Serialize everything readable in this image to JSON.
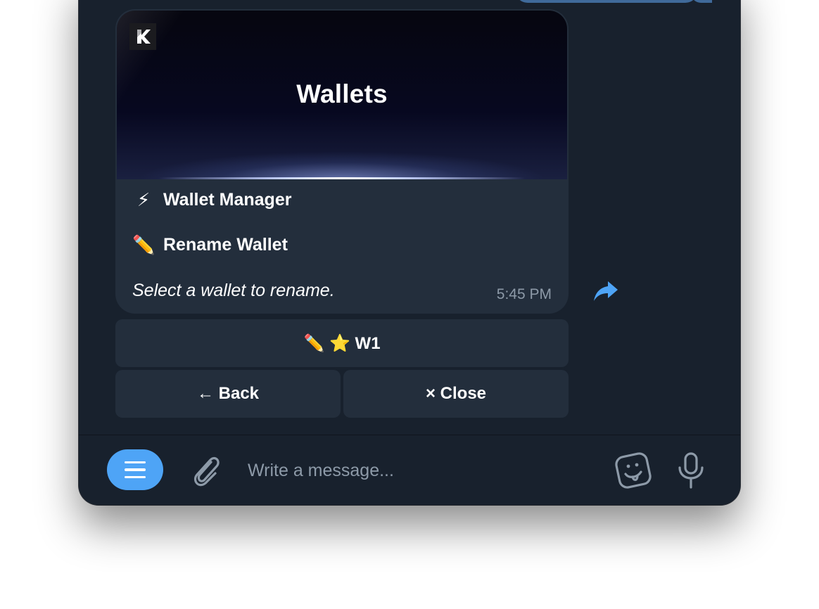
{
  "message": {
    "banner_title": "Wallets",
    "line1_emoji": "⚡",
    "line1_text": "Wallet Manager",
    "line2_emoji": "✏️",
    "line2_text": "Rename Wallet",
    "prompt": "Select a wallet to rename.",
    "time": "5:45 PM"
  },
  "keyboard": {
    "wallet_button": "✏️ ⭐ W1",
    "back_button": "← Back",
    "close_button": "× Close"
  },
  "composer": {
    "placeholder": "Write a message..."
  },
  "colors": {
    "window_bg": "#18212d",
    "bubble_bg": "#232e3c",
    "accent": "#4ea4f6",
    "muted": "#8d9aa8"
  }
}
